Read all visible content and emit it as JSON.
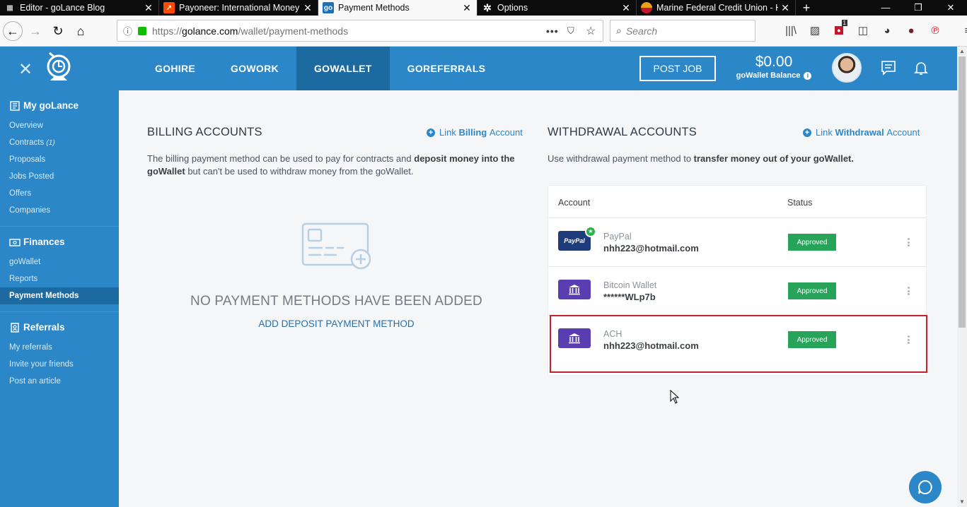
{
  "browser": {
    "tabs": [
      {
        "title": "Editor - goLance Blog",
        "icon": "blog-icon",
        "active": false
      },
      {
        "title": "Payoneer: International Money",
        "icon": "payoneer-icon",
        "active": false
      },
      {
        "title": "Payment Methods",
        "icon": "golance-icon",
        "active": true
      },
      {
        "title": "Options",
        "icon": "gear-icon",
        "active": false
      },
      {
        "title": "Marine Federal Credit Union - H",
        "icon": "credit-union-icon",
        "active": false
      }
    ],
    "url_prefix": "https://",
    "url_domain": "golance.com",
    "url_path": "/wallet/payment-methods",
    "search_placeholder": "Search",
    "pinned_badge": "1"
  },
  "header": {
    "nav": [
      {
        "label": "GOHIRE",
        "active": false
      },
      {
        "label": "GOWORK",
        "active": false
      },
      {
        "label": "GOWALLET",
        "active": true
      },
      {
        "label": "GOREFERRALS",
        "active": false
      }
    ],
    "post_job": "POST JOB",
    "balance_amount": "$0.00",
    "balance_label": "goWallet Balance",
    "accent": "#2b87c8"
  },
  "sidebar": {
    "groups": [
      {
        "title": "My goLance",
        "icon": "dashboard-icon",
        "items": [
          {
            "label": "Overview"
          },
          {
            "label": "Contracts",
            "count": "(1)"
          },
          {
            "label": "Proposals"
          },
          {
            "label": "Jobs Posted"
          },
          {
            "label": "Offers"
          },
          {
            "label": "Companies"
          }
        ]
      },
      {
        "title": "Finances",
        "icon": "money-icon",
        "items": [
          {
            "label": "goWallet"
          },
          {
            "label": "Reports"
          },
          {
            "label": "Payment Methods",
            "active": true
          }
        ]
      },
      {
        "title": "Referrals",
        "icon": "referral-icon",
        "items": [
          {
            "label": "My referrals"
          },
          {
            "label": "Invite your friends"
          },
          {
            "label": "Post an article"
          }
        ]
      }
    ]
  },
  "billing": {
    "title": "BILLING ACCOUNTS",
    "link_pre": "Link",
    "link_bold": "Billing",
    "link_post": "Account",
    "desc_1": "The billing payment method can be used to pay for contracts and",
    "desc_bold": "deposit money into the goWallet",
    "desc_2": "but can't be used to withdraw money from the goWallet.",
    "empty_title": "NO PAYMENT METHODS HAVE BEEN ADDED",
    "empty_action": "ADD DEPOSIT PAYMENT METHOD"
  },
  "withdrawal": {
    "title": "WITHDRAWAL ACCOUNTS",
    "link_pre": "Link",
    "link_bold": "Withdrawal",
    "link_post": "Account",
    "desc_1": "Use withdrawal payment method to",
    "desc_bold": "transfer money out of your goWallet.",
    "col_account": "Account",
    "col_status": "Status",
    "accounts": [
      {
        "type": "paypal",
        "logo_text": "PayPal",
        "name": "PayPal",
        "value": "nhh223@hotmail.com",
        "status": "Approved",
        "primary": true
      },
      {
        "type": "bank",
        "name": "Bitcoin Wallet",
        "value": "******WLp7b",
        "status": "Approved",
        "primary": false
      },
      {
        "type": "bank",
        "name": "ACH",
        "value": "nhh223@hotmail.com",
        "status": "Approved",
        "primary": false
      }
    ],
    "status_color": "#27a35a"
  }
}
